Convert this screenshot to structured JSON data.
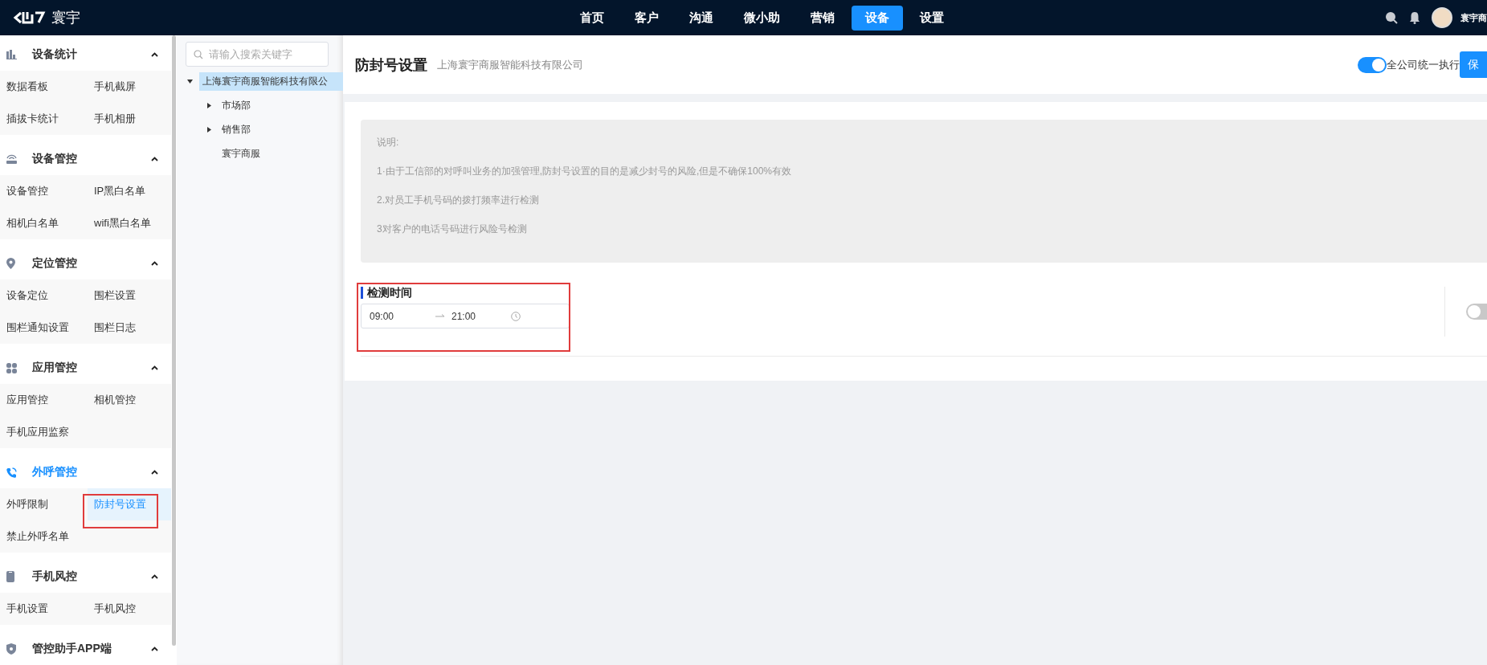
{
  "top_bar": {
    "logo_text": "寰宇",
    "nav": [
      {
        "label": "首页",
        "selected": false
      },
      {
        "label": "客户",
        "selected": false
      },
      {
        "label": "沟通",
        "selected": false
      },
      {
        "label": "微小助",
        "selected": false
      },
      {
        "label": "营销",
        "selected": false
      },
      {
        "label": "设备",
        "selected": true
      },
      {
        "label": "设置",
        "selected": false
      }
    ],
    "user_name": "寰宇商"
  },
  "sidebar": {
    "groups": [
      {
        "title": "设备统计",
        "kind": "stats",
        "active": false,
        "expanded": true,
        "items": [
          {
            "label": "数据看板",
            "selected": false
          },
          {
            "label": "手机截屏",
            "selected": false
          },
          {
            "label": "插拔卡统计",
            "selected": false
          },
          {
            "label": "手机相册",
            "selected": false
          }
        ]
      },
      {
        "title": "设备管控",
        "kind": "device",
        "active": false,
        "expanded": true,
        "items": [
          {
            "label": "设备管控",
            "selected": false
          },
          {
            "label": "IP黑白名单",
            "selected": false
          },
          {
            "label": "相机白名单",
            "selected": false
          },
          {
            "label": "wifi黑白名单",
            "selected": false
          }
        ]
      },
      {
        "title": "定位管控",
        "kind": "location",
        "active": false,
        "expanded": true,
        "items": [
          {
            "label": "设备定位",
            "selected": false
          },
          {
            "label": "围栏设置",
            "selected": false
          },
          {
            "label": "围栏通知设置",
            "selected": false
          },
          {
            "label": "围栏日志",
            "selected": false
          }
        ]
      },
      {
        "title": "应用管控",
        "kind": "apps",
        "active": false,
        "expanded": true,
        "items": [
          {
            "label": "应用管控",
            "selected": false
          },
          {
            "label": "相机管控",
            "selected": false
          },
          {
            "label": "手机应用监察",
            "selected": false
          }
        ]
      },
      {
        "title": "外呼管控",
        "kind": "calls",
        "active": true,
        "expanded": true,
        "items": [
          {
            "label": "外呼限制",
            "selected": false
          },
          {
            "label": "防封号设置",
            "selected": true
          },
          {
            "label": "禁止外呼名单",
            "selected": false
          }
        ]
      },
      {
        "title": "手机风控",
        "kind": "phone",
        "active": false,
        "expanded": true,
        "items": [
          {
            "label": "手机设置",
            "selected": false
          },
          {
            "label": "手机风控",
            "selected": false
          }
        ]
      },
      {
        "title": "管控助手APP端",
        "kind": "shield",
        "active": false,
        "expanded": true
      }
    ]
  },
  "org_tree": {
    "search": {
      "placeholder": "请输入搜索关键字"
    },
    "nodes": [
      {
        "label": "上海寰宇商服智能科技有限公",
        "selected": true,
        "expanded": true,
        "children": [
          {
            "label": "市场部",
            "selected": false,
            "expanded": false
          },
          {
            "label": "销售部",
            "selected": false,
            "expanded": false
          },
          {
            "label": "寰宇商服",
            "selected": false
          }
        ]
      }
    ]
  },
  "header": {
    "title": "防封号设置",
    "subtitle": "上海寰宇商服智能科技有限公司",
    "unify_toggle": {
      "on": true,
      "label": "全公司统一执行"
    },
    "save_button": "保"
  },
  "notice": {
    "title": "说明:",
    "lines": [
      "1·由于工信部的对呼叫业务的加强管理,防封号设置的目的是减少封号的风险,但是不确保100%有效",
      "2.对员工手机号码的拨打频率进行检测",
      "3对客户的电话号码进行风险号检测"
    ]
  },
  "detection": {
    "title": "检测时间",
    "start": "09:00",
    "end": "21:00",
    "toggle_on": false
  }
}
